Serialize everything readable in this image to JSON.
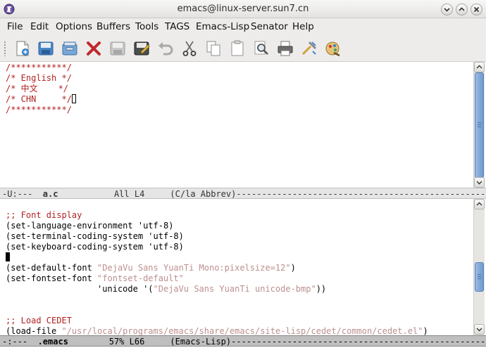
{
  "window": {
    "title": "emacs@linux-server.sun7.cn"
  },
  "menu": [
    "File",
    "Edit",
    "Options",
    "Buffers",
    "Tools",
    "TAGS",
    "Emacs-Lisp",
    "Senator",
    "Help"
  ],
  "toolbar": {
    "tools": [
      "new-file-icon",
      "save-icon",
      "open-folder-icon",
      "close-icon",
      "save-disabled-icon",
      "save-as-icon",
      "undo-icon",
      "cut-icon",
      "copy-icon",
      "paste-icon",
      "search-icon",
      "print-icon",
      "customize-icon",
      "help-icon"
    ]
  },
  "top_window": {
    "lines": [
      [
        {
          "t": "/***********/",
          "c": "comment"
        }
      ],
      [
        {
          "t": "/* English */",
          "c": "comment"
        }
      ],
      [
        {
          "t": "/* 中文    */",
          "c": "comment"
        }
      ],
      [
        {
          "t": "/* CHN     */",
          "c": "comment"
        },
        {
          "cursor": "box"
        }
      ],
      [
        {
          "t": "/***********/",
          "c": "comment"
        }
      ]
    ],
    "modeline": {
      "prefix": "-U:---  ",
      "buffer": "a.c",
      "info": "           All L4     (C/la Abbrev)"
    }
  },
  "bottom_window": {
    "lines": [
      [],
      [
        {
          "t": ";; Font display",
          "c": "comment"
        }
      ],
      [
        {
          "t": "(set-language-environment 'utf-8)"
        }
      ],
      [
        {
          "t": "(set-terminal-coding-system 'utf-8)"
        }
      ],
      [
        {
          "t": "(set-keyboard-coding-system 'utf-8)"
        }
      ],
      [
        {
          "cursor": "block"
        }
      ],
      [
        {
          "t": "(set-default-font "
        },
        {
          "t": "\"DejaVu Sans YuanTi Mono:pixelsize=12\"",
          "c": "string"
        },
        {
          "t": ")"
        }
      ],
      [
        {
          "t": "(set-fontset-font "
        },
        {
          "t": "\"fontset-default\"",
          "c": "string"
        }
      ],
      [
        {
          "t": "                  'unicode '("
        },
        {
          "t": "\"DejaVu Sans YuanTi unicode-bmp\"",
          "c": "string"
        },
        {
          "t": "))"
        }
      ],
      [],
      [],
      [
        {
          "t": ";; Load CEDET",
          "c": "comment"
        }
      ],
      [
        {
          "t": "(load-file "
        },
        {
          "t": "\"/usr/local/programs/emacs/share/emacs/site-lisp/cedet/common/cedet.el\"",
          "c": "string"
        },
        {
          "t": ")"
        }
      ]
    ],
    "modeline": {
      "prefix": "-:---  ",
      "buffer": ".emacs",
      "info": "        57% L66     (Emacs-Lisp)"
    }
  },
  "colors": {
    "comment": "#b22222",
    "string": "#bc8f8f",
    "scrollbar_thumb": "#6f98cf"
  }
}
